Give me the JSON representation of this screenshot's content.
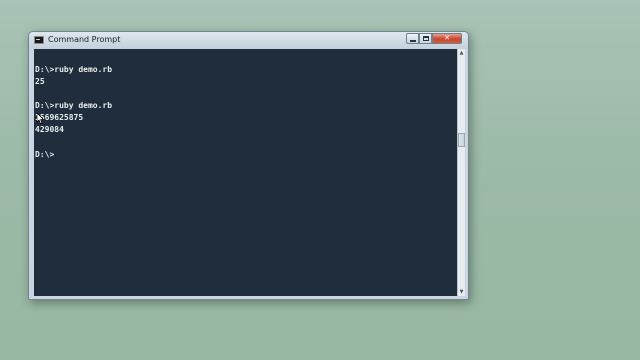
{
  "window": {
    "title": "Command Prompt",
    "icon": "cmd-icon",
    "controls": {
      "minimize": "minimize-icon",
      "maximize": "maximize-icon",
      "close_label": "✕"
    }
  },
  "console": {
    "lines": [
      "",
      "D:\\>ruby demo.rb",
      "25",
      "",
      "D:\\>ruby demo.rb",
      "1569625875",
      "429084",
      "",
      "D:\\>"
    ],
    "background": "#1f2d3c",
    "text_color": "#e8ecef"
  },
  "scrollbar": {
    "up_arrow": "▲",
    "down_arrow": "▼"
  }
}
